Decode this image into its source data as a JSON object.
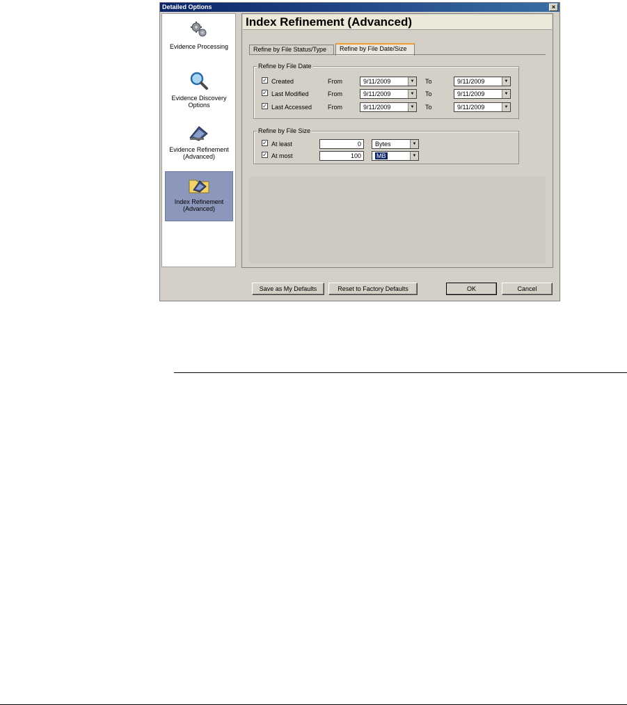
{
  "window": {
    "title": "Detailed Options",
    "close_glyph": "×"
  },
  "nav": {
    "items": [
      {
        "label": "Evidence Processing",
        "icon": "gears-icon"
      },
      {
        "label": "Evidence Discovery Options",
        "icon": "magnifier-icon"
      },
      {
        "label": "Evidence Refinement (Advanced)",
        "icon": "stapler-icon"
      },
      {
        "label": "Index Refinement (Advanced)",
        "icon": "folder-stapler-icon",
        "selected": true
      }
    ]
  },
  "header": {
    "title": "Index Refinement (Advanced)"
  },
  "tabs": [
    {
      "label": "Refine by File Status/Type",
      "active": false
    },
    {
      "label": "Refine by File Date/Size",
      "active": true
    }
  ],
  "date_group": {
    "legend": "Refine by File Date",
    "from_label": "From",
    "to_label": "To",
    "rows": [
      {
        "label": "Created",
        "checked": true,
        "from": "9/11/2009",
        "to": "9/11/2009"
      },
      {
        "label": "Last Modified",
        "checked": true,
        "from": "9/11/2009",
        "to": "9/11/2009"
      },
      {
        "label": "Last Accessed",
        "checked": true,
        "from": "9/11/2009",
        "to": "9/11/2009"
      }
    ]
  },
  "size_group": {
    "legend": "Refine by File Size",
    "rows": [
      {
        "label": "At least",
        "checked": true,
        "value": "0",
        "unit": "Bytes"
      },
      {
        "label": "At most",
        "checked": true,
        "value": "100",
        "unit": "MB"
      }
    ]
  },
  "buttons": {
    "save_defaults": "Save as My Defaults",
    "reset_defaults": "Reset to Factory Defaults",
    "ok": "OK",
    "cancel": "Cancel"
  },
  "glyphs": {
    "check": "✓",
    "dropdown": "▼"
  }
}
